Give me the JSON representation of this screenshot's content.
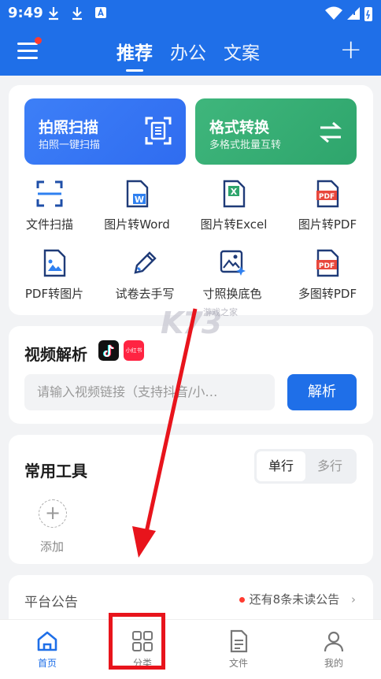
{
  "status_bar": {
    "time": "9:49"
  },
  "header": {
    "tabs": [
      {
        "label": "推荐",
        "active": true
      },
      {
        "label": "办公",
        "active": false
      },
      {
        "label": "文案",
        "active": false
      }
    ],
    "accent": "#1f6fe8"
  },
  "quick_actions": {
    "scan": {
      "title": "拍照扫描",
      "subtitle": "拍照一键扫描"
    },
    "convert": {
      "title": "格式转换",
      "subtitle": "多格式批量互转"
    }
  },
  "tools": [
    {
      "label": "文件扫描",
      "icon": "scan-frame-icon"
    },
    {
      "label": "图片转Word",
      "icon": "word-file-icon"
    },
    {
      "label": "图片转Excel",
      "icon": "excel-file-icon"
    },
    {
      "label": "图片转PDF",
      "icon": "pdf-file-icon"
    },
    {
      "label": "PDF转图片",
      "icon": "image-file-icon"
    },
    {
      "label": "试卷去手写",
      "icon": "pen-icon"
    },
    {
      "label": "寸照换底色",
      "icon": "photo-sparkle-icon"
    },
    {
      "label": "多图转PDF",
      "icon": "pdf-file-icon"
    }
  ],
  "video_parse": {
    "title": "视频解析",
    "xhs_badge": "小红书",
    "placeholder": "请输入视频链接（支持抖音/小…",
    "button": "解析"
  },
  "common_tools": {
    "title": "常用工具",
    "segments": [
      "单行",
      "多行"
    ],
    "add_label": "添加"
  },
  "notice": {
    "title": "平台公告",
    "unread": "还有8条未读公告"
  },
  "watermark": {
    "text": "K73",
    "small": "游戏之家"
  },
  "bottom_nav": [
    {
      "label": "首页",
      "icon": "home-icon",
      "active": true
    },
    {
      "label": "分类",
      "icon": "grid-icon",
      "active": false
    },
    {
      "label": "文件",
      "icon": "file-icon",
      "active": false
    },
    {
      "label": "我的",
      "icon": "user-icon",
      "active": false
    }
  ],
  "colors": {
    "scan": "#2f6cf0",
    "convert": "#2ea56c",
    "annotation": "#e8141c"
  }
}
